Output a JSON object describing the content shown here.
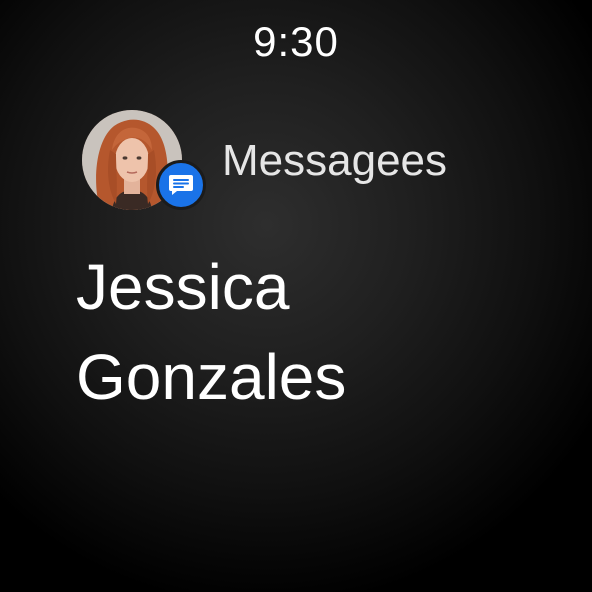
{
  "status": {
    "time": "9:30"
  },
  "notification": {
    "app_name": "Messagees",
    "app_icon": "messages-icon",
    "avatar": "contact-avatar",
    "contact": {
      "first_name": "Jessica",
      "last_name": "Gonzales"
    }
  },
  "colors": {
    "badge": "#1a73e8",
    "background": "#000000",
    "text_primary": "#ffffff",
    "text_secondary": "#e6e6e6"
  }
}
